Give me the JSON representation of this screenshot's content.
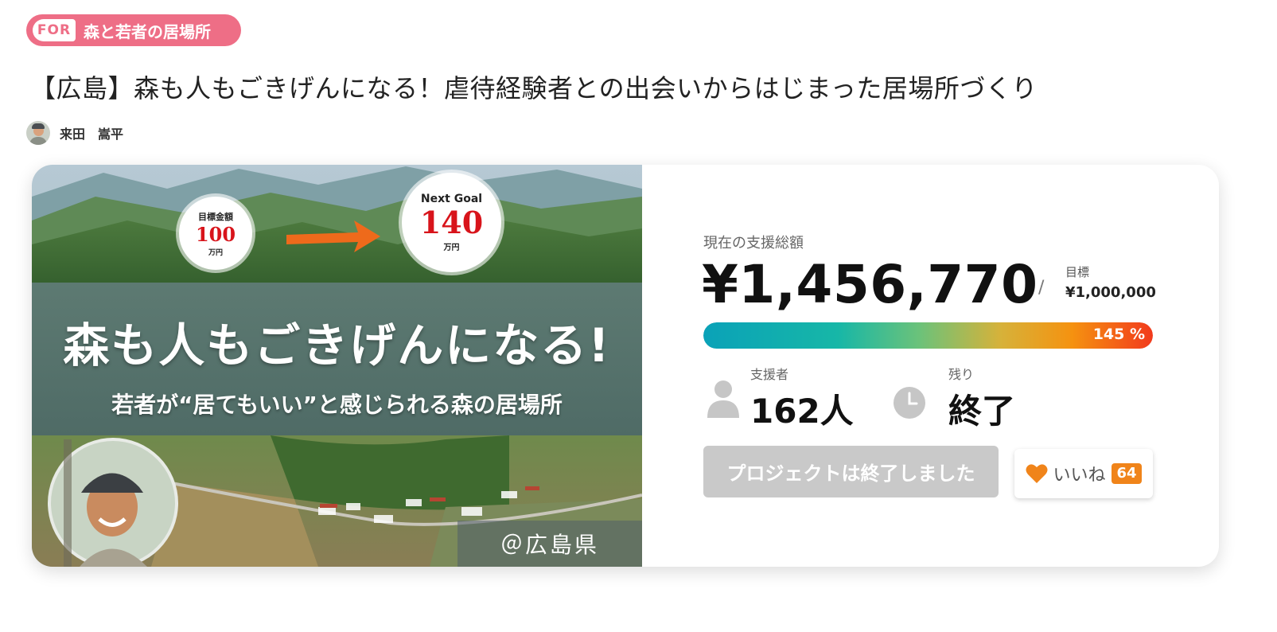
{
  "badge": {
    "prefix": "FOR",
    "label": "森と若者の居場所"
  },
  "title": "【広島】森も人もごきげんになる！虐待経験者との出会いからはじまった居場所づくり",
  "author": {
    "name": "来田　嵩平",
    "avatar": "avatar-photo"
  },
  "hero": {
    "headline": "森も人もごきげんになる!",
    "subline": "若者が“居てもいい”と感じられる森の居場所",
    "goal_badge": {
      "label": "目標金額",
      "value": "100",
      "unit": "万円"
    },
    "next_goal_badge": {
      "label": "Next Goal",
      "value": "140",
      "unit": "万円"
    },
    "location": "＠広島県"
  },
  "stats": {
    "total_caption": "現在の支援総額",
    "total_amount": "¥1,456,770",
    "separator": "/",
    "goal_caption": "目標",
    "goal_amount": "¥1,000,000",
    "progress_percent": 145,
    "progress_label": "145 %",
    "supporters_caption": "支援者",
    "supporters_value": "162人",
    "remaining_caption": "残り",
    "remaining_value": "終了"
  },
  "actions": {
    "ended_label": "プロジェクトは終了しました",
    "like_label": "いいね",
    "like_count": "64"
  },
  "colors": {
    "badge": "#ee6e86",
    "like_accent": "#f0841a",
    "button_disabled": "#c9c9c9"
  }
}
